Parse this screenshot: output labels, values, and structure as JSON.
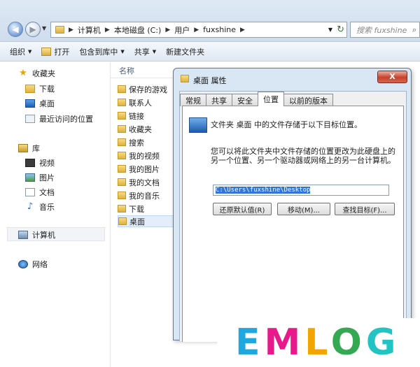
{
  "address_bar": {
    "breadcrumbs": [
      "计算机",
      "本地磁盘 (C:)",
      "用户",
      "fuxshine"
    ],
    "search_placeholder": "搜索 fuxshine"
  },
  "toolbar": {
    "items": [
      "组织",
      "打开",
      "包含到库中",
      "共享",
      "新建文件夹"
    ]
  },
  "nav_pane": {
    "favorites_label": "收藏夹",
    "favorites": [
      "下载",
      "桌面",
      "最近访问的位置"
    ],
    "libraries_label": "库",
    "libraries": [
      "视频",
      "图片",
      "文档",
      "音乐"
    ],
    "computer_label": "计算机",
    "network_label": "网络"
  },
  "file_list": {
    "column_name": "名称",
    "items": [
      "保存的游戏",
      "联系人",
      "链接",
      "收藏夹",
      "搜索",
      "我的视频",
      "我的图片",
      "我的文档",
      "我的音乐",
      "下载",
      "桌面"
    ],
    "selected": "桌面"
  },
  "dialog": {
    "title": "桌面 属性",
    "close": "X",
    "tabs": [
      "常规",
      "共享",
      "安全",
      "位置",
      "以前的版本"
    ],
    "active_tab": "位置",
    "line1": "文件夹 桌面 中的文件存储于以下目标位置。",
    "line2": "您可以将此文件夹中文件存储的位置更改为此硬盘上的另一个位置、另一个驱动器或网络上的另一台计算机。",
    "path": "C:\\Users\\fuxshine\\Desktop",
    "btn_restore": "还原默认值(R)",
    "btn_move": "移动(M)...",
    "btn_find": "查找目标(F)..."
  },
  "watermark": {
    "text": "EMLOG",
    "letters": [
      "E",
      "M",
      "L",
      "O",
      "G"
    ],
    "colors": [
      "#1fa7e0",
      "#e8198b",
      "#f2a400",
      "#34a853",
      "#22c3c3"
    ]
  }
}
